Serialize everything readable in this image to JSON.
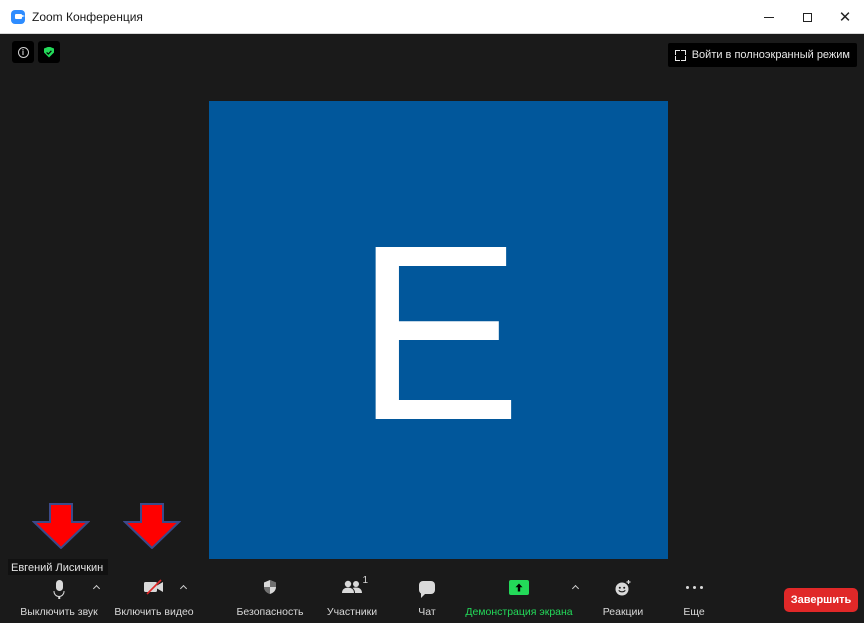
{
  "window": {
    "title": "Zoom Конференция",
    "controls": {
      "minimize": "—",
      "maximize": "☐",
      "close": "✕"
    }
  },
  "top_bar": {
    "info_icon": "info-circle-icon",
    "security_icon": "green-shield-icon",
    "fullscreen_label": "Войти в полноэкранный режим"
  },
  "video": {
    "avatar_letter": "E",
    "tile_color": "#01579b",
    "participant_name": "Евгений Лисичкин"
  },
  "annotations": {
    "arrow_color": "#ff0000",
    "arrow_outline": "#3b4a8a"
  },
  "toolbar": {
    "mute_label": "Выключить звук",
    "video_label": "Включить видео",
    "security_label": "Безопасность",
    "participants_label": "Участники",
    "participants_count": "1",
    "chat_label": "Чат",
    "share_label": "Демонстрация экрана",
    "reactions_label": "Реакции",
    "more_label": "Еще",
    "end_label": "Завершить"
  },
  "colors": {
    "background": "#1a1a1a",
    "accent_green": "#23d959",
    "end_red": "#e02828"
  }
}
